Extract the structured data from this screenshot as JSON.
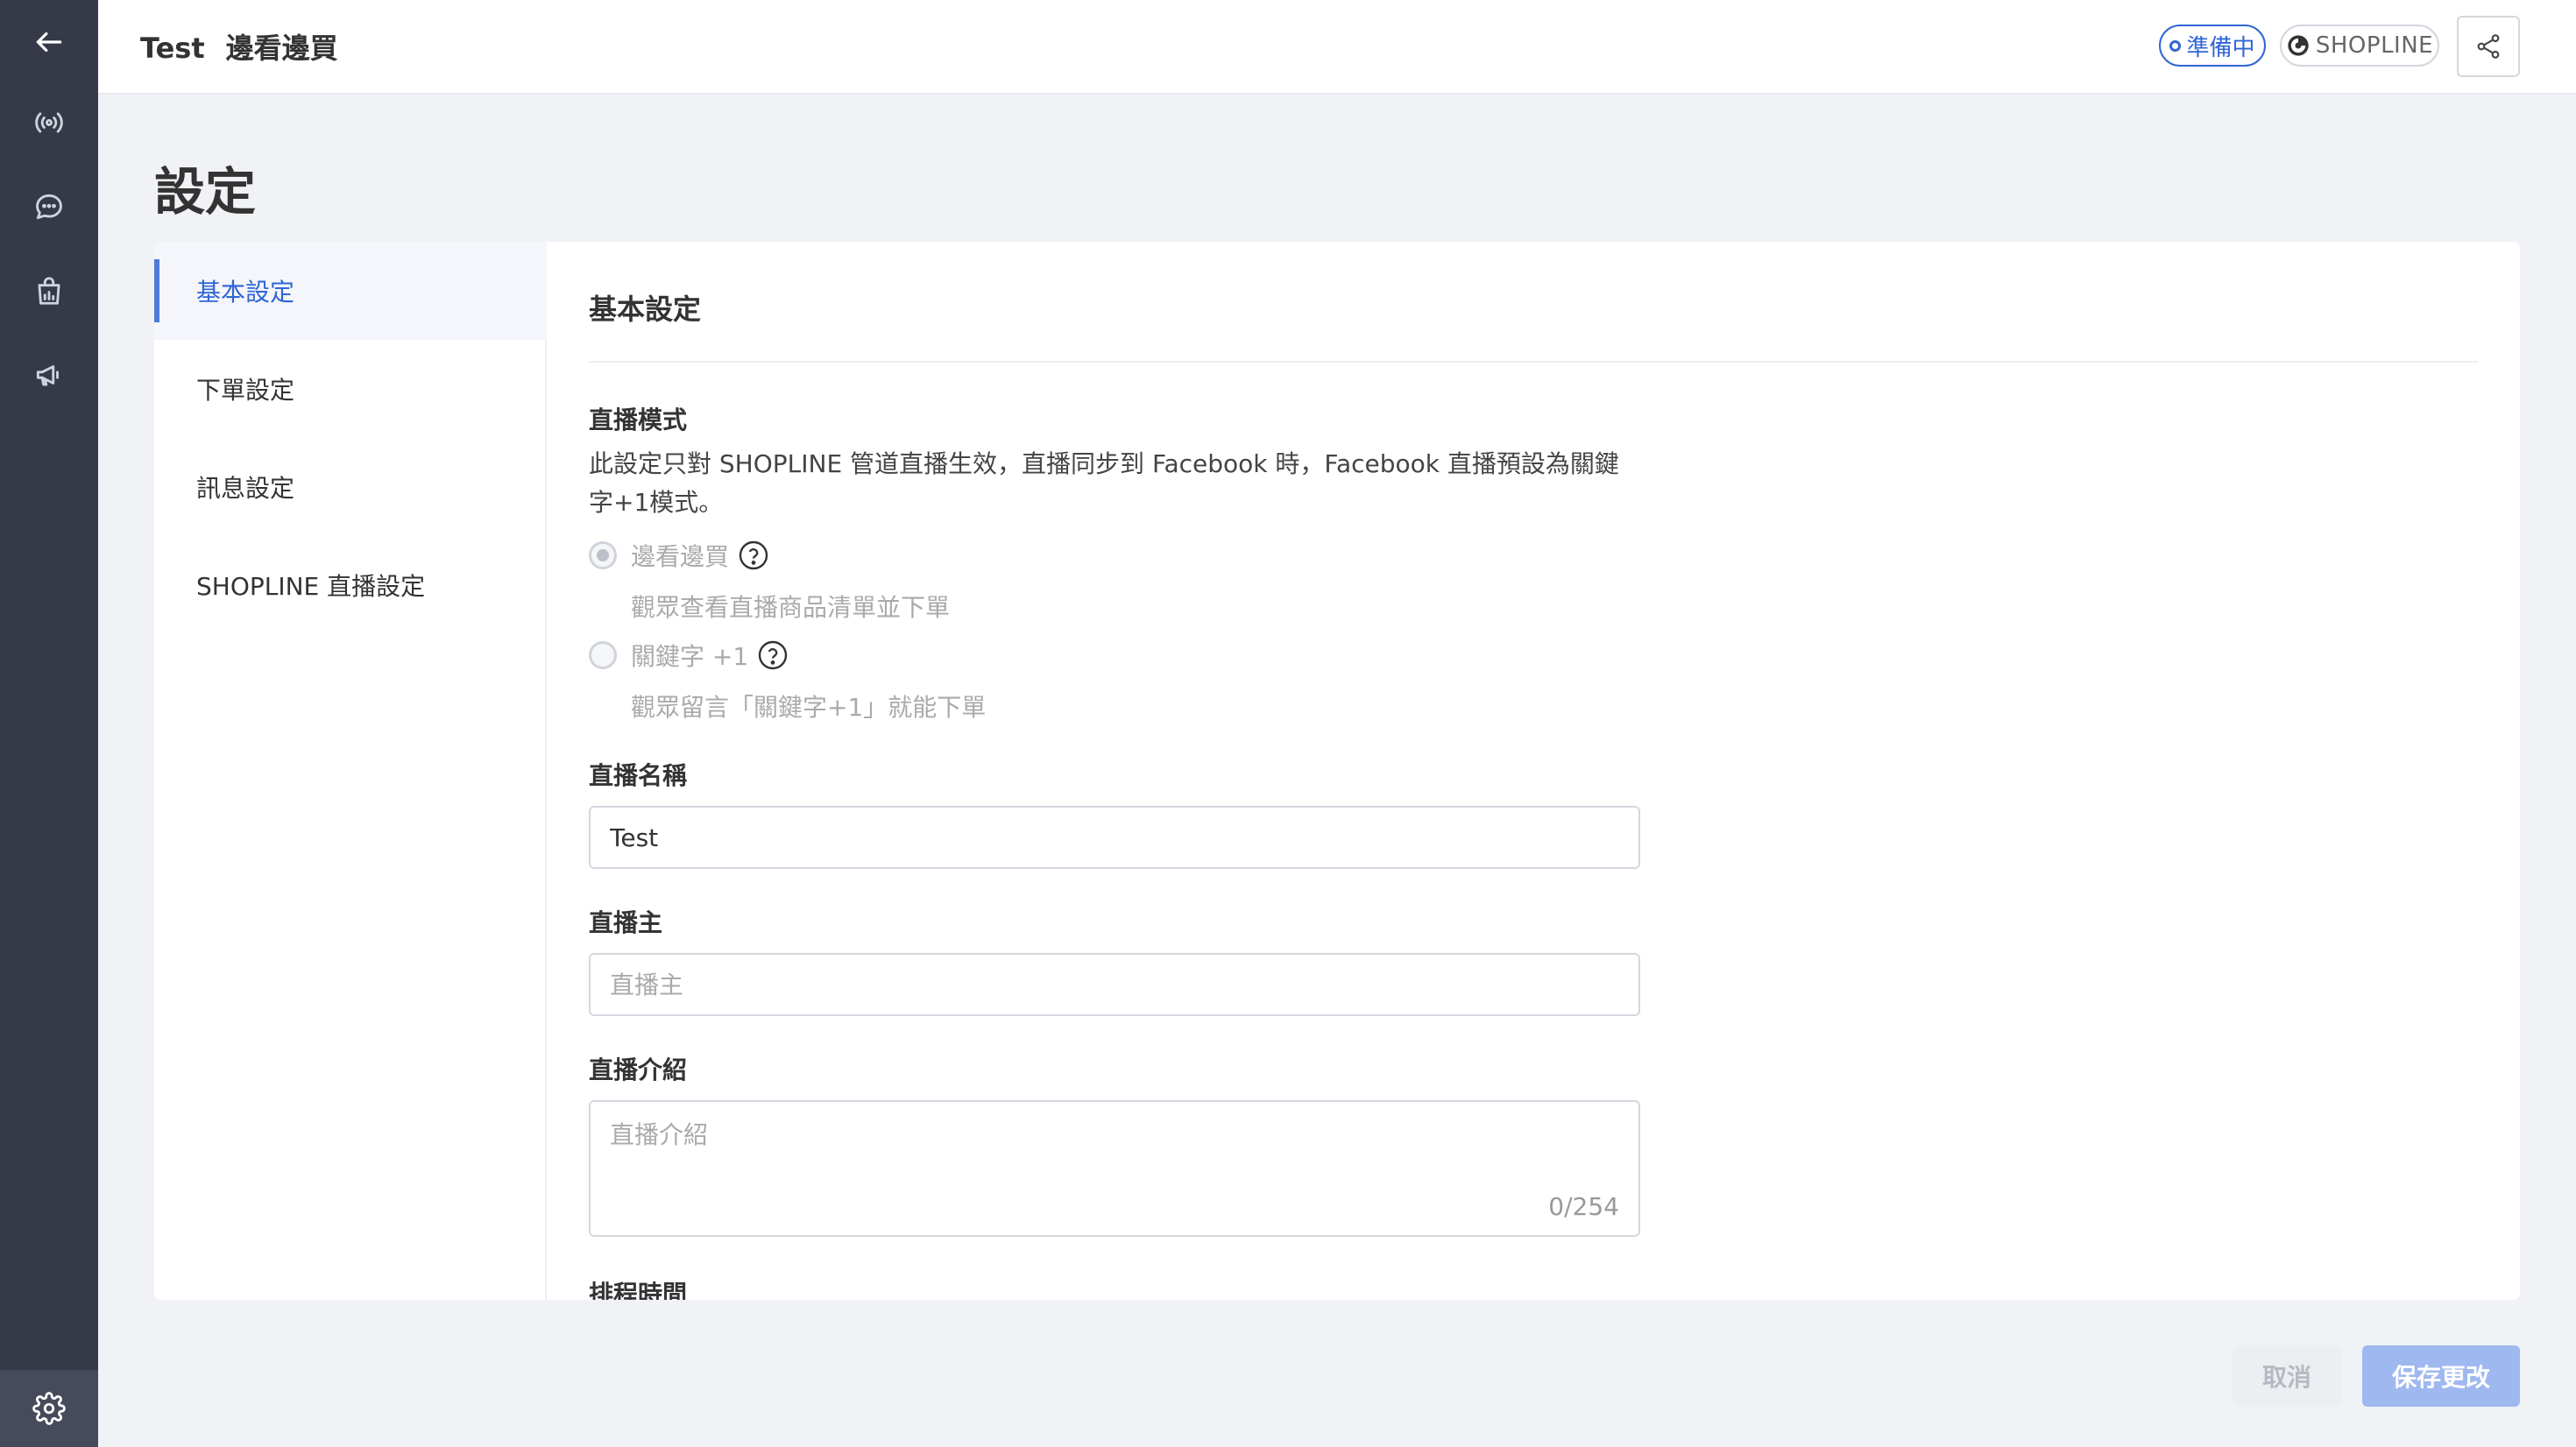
{
  "header": {
    "title": "Test",
    "subtitle": "邊看邊買",
    "status": "準備中",
    "channel": "SHOPLINE"
  },
  "page": {
    "title": "設定"
  },
  "sidebar": {
    "items": [
      {
        "label": "基本設定",
        "active": true
      },
      {
        "label": "下單設定",
        "active": false
      },
      {
        "label": "訊息設定",
        "active": false
      },
      {
        "label": "SHOPLINE 直播設定",
        "active": false
      }
    ]
  },
  "content": {
    "section_title": "基本設定",
    "live_mode": {
      "label": "直播模式",
      "description": "此設定只對 SHOPLINE 管道直播生效，直播同步到 Facebook 時，Facebook 直播預設為關鍵字+1模式。",
      "options": [
        {
          "label": "邊看邊買",
          "desc": "觀眾查看直播商品清單並下單",
          "selected": true
        },
        {
          "label": "關鍵字 +1",
          "desc": "觀眾留言「關鍵字+1」就能下單",
          "selected": false
        }
      ]
    },
    "live_name": {
      "label": "直播名稱",
      "value": "Test"
    },
    "host": {
      "label": "直播主",
      "placeholder": "直播主"
    },
    "intro": {
      "label": "直播介紹",
      "placeholder": "直播介紹",
      "counter": "0/254"
    },
    "schedule": {
      "label": "排程時間"
    }
  },
  "footer": {
    "cancel_label": "取消",
    "save_label": "保存更改"
  },
  "colors": {
    "rail": "#363a48",
    "accent": "#2f65d6",
    "save_button": "#9fb8ef"
  }
}
